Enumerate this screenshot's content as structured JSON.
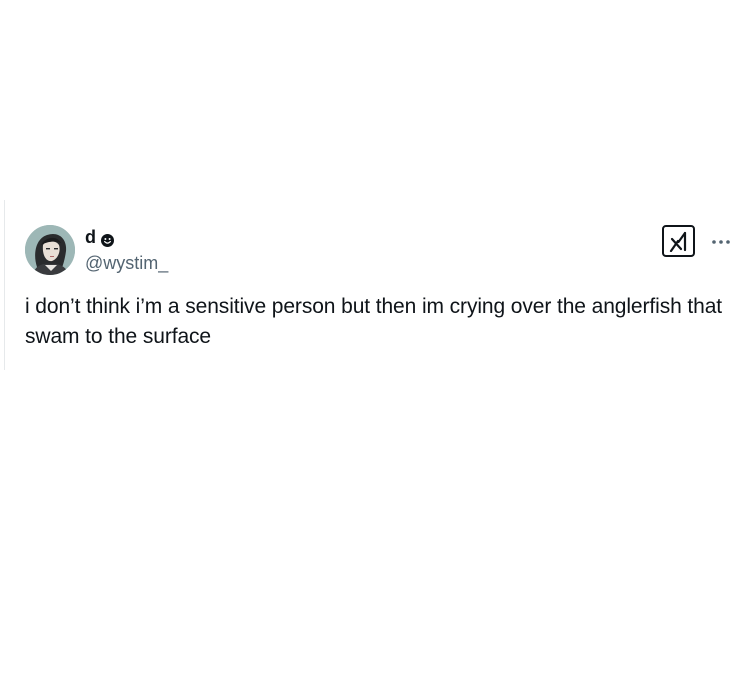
{
  "tweet": {
    "display_name": "d",
    "handle": "@wystim_",
    "text": "i don’t think i’m a sensitive person but then im crying over the anglerfish that swam to the surface"
  },
  "icons": {
    "verified_badge": "smiley-face-icon",
    "grok": "grok-icon",
    "more": "more-options-icon"
  },
  "colors": {
    "text": "#0f1419",
    "secondary_text": "#536471",
    "background": "#ffffff"
  }
}
